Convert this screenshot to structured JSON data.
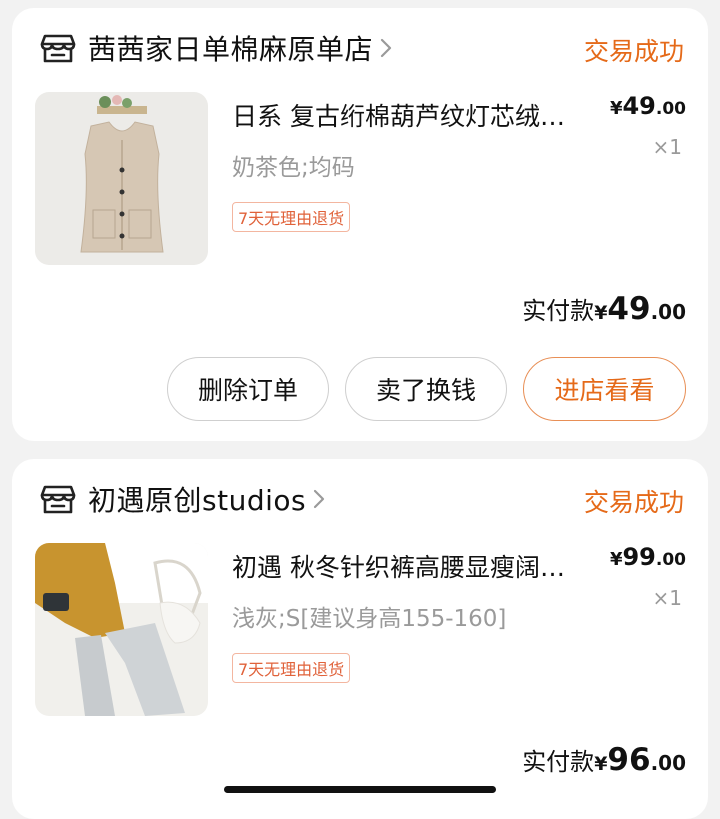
{
  "orders": [
    {
      "shop_name": "茜茜家日单棉麻原单店",
      "status": "交易成功",
      "product_title": "日系 复古绗棉葫芦纹灯芯绒…",
      "variant": "奶茶色;均码",
      "tag": "7天无理由退货",
      "price_symbol": "¥",
      "price_int": "49",
      "price_dec": ".00",
      "quantity": "×1",
      "paid_label": "实付款",
      "paid_symbol": "¥",
      "paid_int": "49",
      "paid_dec": ".00",
      "buttons": {
        "delete": "删除订单",
        "sell": "卖了换钱",
        "visit": "进店看看"
      }
    },
    {
      "shop_name": "初遇原创studios",
      "status": "交易成功",
      "product_title": "初遇 秋冬针织裤高腰显瘦阔…",
      "variant": "浅灰;S[建议身高155-160]",
      "tag": "7天无理由退货",
      "price_symbol": "¥",
      "price_int": "99",
      "price_dec": ".00",
      "quantity": "×1",
      "paid_label": "实付款",
      "paid_symbol": "¥",
      "paid_int": "96",
      "paid_dec": ".00"
    }
  ],
  "colors": {
    "accent": "#e56a19",
    "tag": "#e0623a",
    "muted": "#9a9a9a",
    "background": "#f2f2f2"
  },
  "icons": [
    "store-icon",
    "chevron-right-icon"
  ]
}
